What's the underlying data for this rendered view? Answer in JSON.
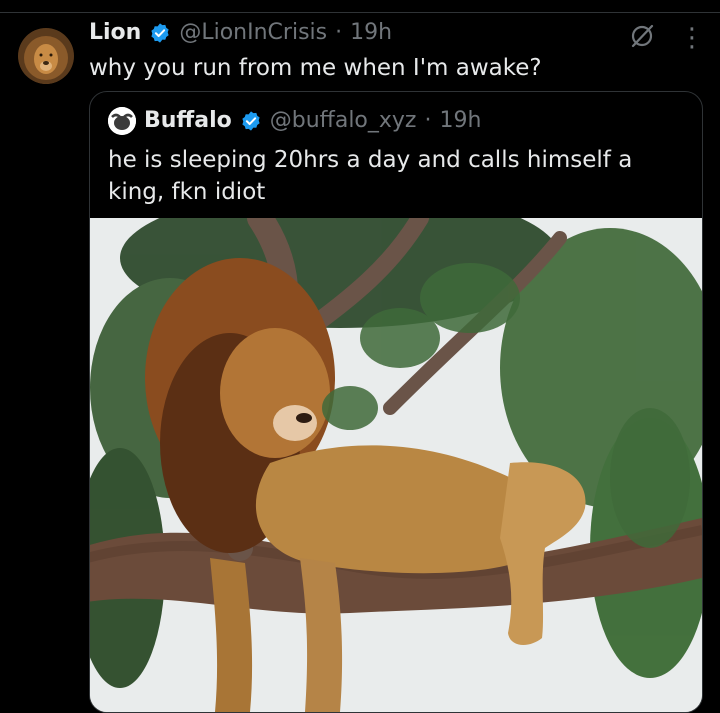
{
  "tweet": {
    "author_name": "Lion",
    "author_handle": "@LionInCrisis",
    "separator": "·",
    "time": "19h",
    "text": "why you run from me when I'm awake?"
  },
  "quoted_tweet": {
    "author_name": "Buffalo",
    "author_handle": "@buffalo_xyz",
    "separator": "·",
    "time": "19h",
    "text": "he is sleeping 20hrs a day and calls himself a king, fkn idiot",
    "image_alt": "lion sleeping on a tree branch"
  },
  "icons": {
    "verified": "verified-badge-icon",
    "grok": "grok-icon",
    "more": "more-options-icon"
  },
  "colors": {
    "background": "#000000",
    "text": "#e7e9ea",
    "secondary_text": "#71767b",
    "border": "#2f3336",
    "verified": "#1d9bf0"
  }
}
